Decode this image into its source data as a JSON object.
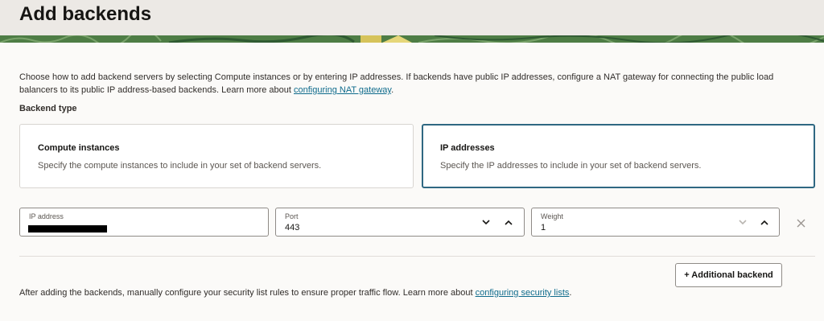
{
  "page": {
    "title": "Add backends"
  },
  "intro": {
    "text": "Choose how to add backend servers by selecting Compute instances or by entering IP addresses. If backends have public IP addresses, configure a NAT gateway for connecting the public load balancers to its public IP address-based backends. Learn more about ",
    "link": "configuring NAT gateway",
    "suffix": "."
  },
  "backend_type": {
    "label": "Backend type",
    "options": [
      {
        "title": "Compute instances",
        "description": "Specify the compute instances to include in your set of backend servers.",
        "selected": false
      },
      {
        "title": "IP addresses",
        "description": "Specify the IP addresses to include in your set of backend servers.",
        "selected": true
      }
    ]
  },
  "backend_row": {
    "ip": {
      "label": "IP address",
      "value": ""
    },
    "port": {
      "label": "Port",
      "value": "443"
    },
    "weight": {
      "label": "Weight",
      "value": "1"
    }
  },
  "icons": {
    "decrement": "chevron-down-icon",
    "increment": "chevron-up-icon",
    "remove": "close-icon"
  },
  "actions": {
    "add_backend": "+ Additional backend"
  },
  "footer": {
    "text": "After adding the backends, manually configure your security list rules to ensure proper traffic flow. Learn more about ",
    "link": "configuring security lists",
    "suffix": "."
  },
  "colors": {
    "selected_border": "#2f6882",
    "link": "#0f6b8c",
    "header_band": "#4e7d45"
  }
}
